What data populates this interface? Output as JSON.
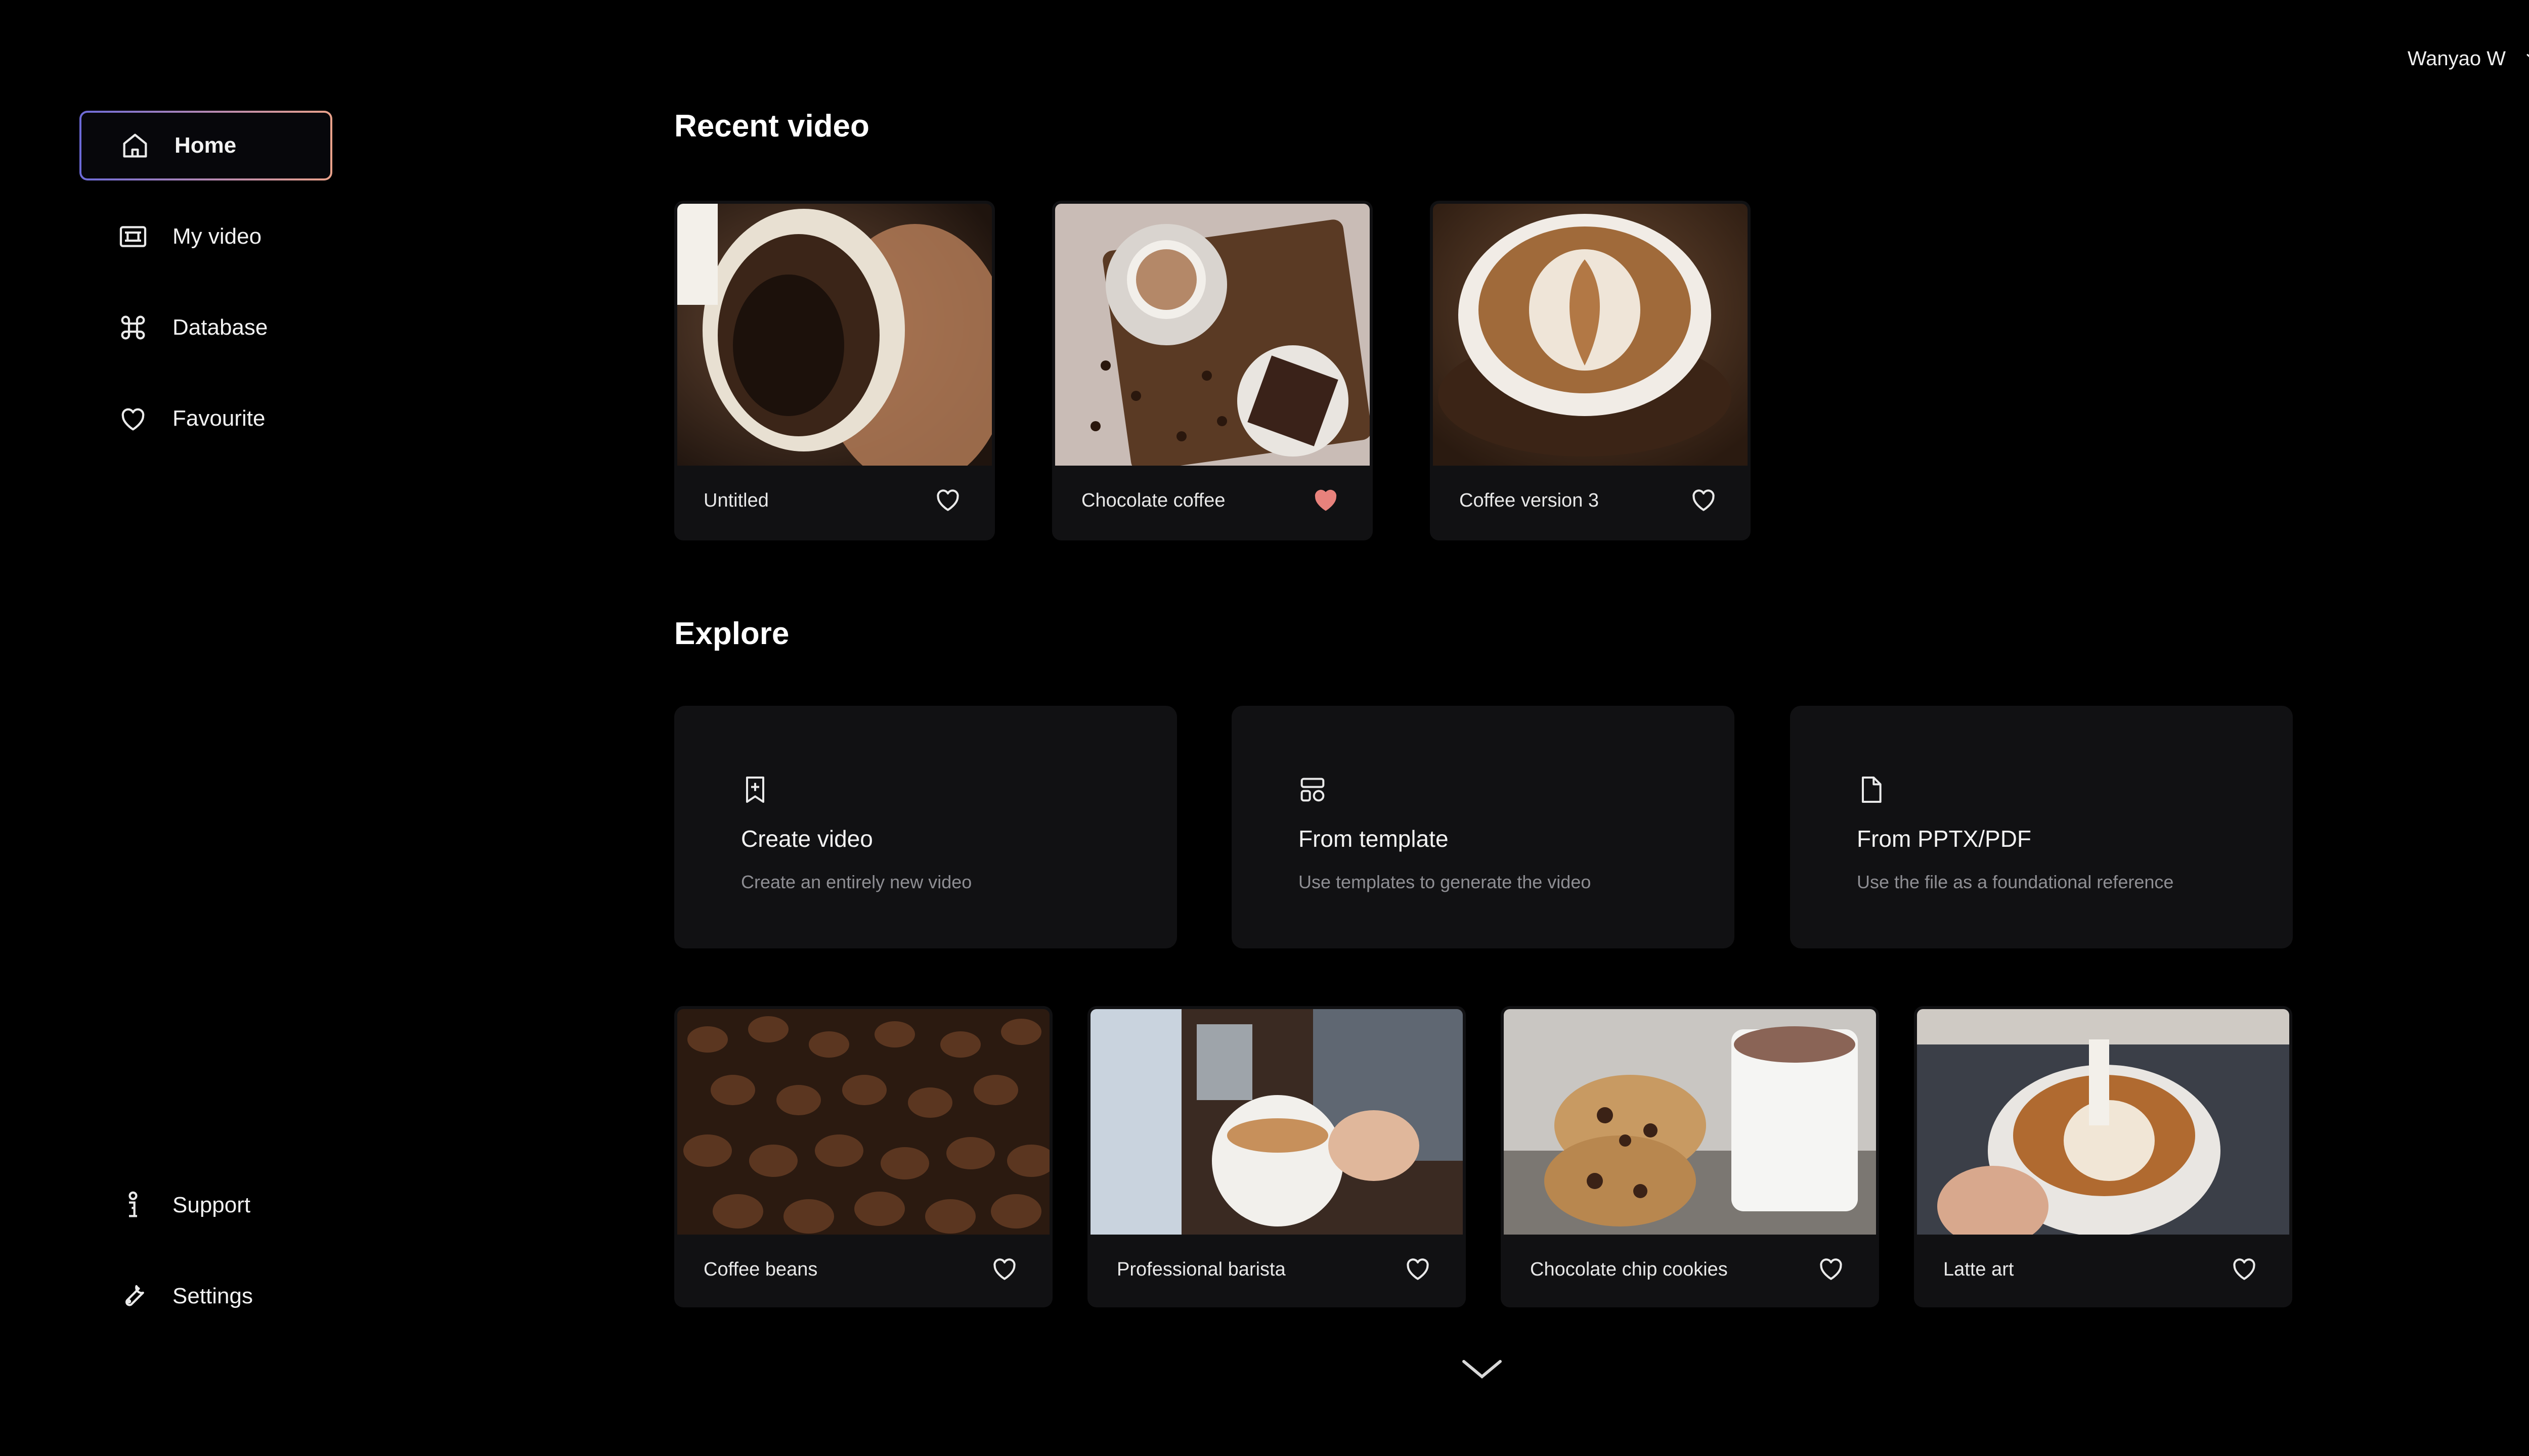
{
  "sidebar": {
    "items": [
      {
        "label": "Home",
        "icon": "home-icon",
        "active": true
      },
      {
        "label": "My video",
        "icon": "film-icon"
      },
      {
        "label": "Database",
        "icon": "command-icon"
      },
      {
        "label": "Favourite",
        "icon": "heart-icon"
      }
    ],
    "bottom_items": [
      {
        "label": "Support",
        "icon": "support-icon"
      },
      {
        "label": "Settings",
        "icon": "wrench-icon"
      }
    ]
  },
  "user": {
    "name": "Wanyao W",
    "icon": "chevron-down-icon"
  },
  "recent": {
    "title": "Recent video",
    "items": [
      {
        "title": "Untitled",
        "favourite": false
      },
      {
        "title": "Chocolate coffee",
        "favourite": true
      },
      {
        "title": "Coffee version 3",
        "favourite": false
      }
    ]
  },
  "explore": {
    "title": "Explore",
    "options": [
      {
        "title": "Create video",
        "desc": "Create an entirely new video",
        "icon": "sparkle-doc-icon"
      },
      {
        "title": "From template",
        "desc": "Use templates to generate the video",
        "icon": "template-icon"
      },
      {
        "title": "From PPTX/PDF",
        "desc": "Use the file as a foundational reference",
        "icon": "file-icon"
      }
    ],
    "items": [
      {
        "title": "Coffee beans",
        "favourite": false
      },
      {
        "title": "Professional barista",
        "favourite": false
      },
      {
        "title": "Chocolate chip cookies",
        "favourite": false
      },
      {
        "title": "Latte art",
        "favourite": false
      }
    ]
  },
  "colors": {
    "background": "#000000",
    "card": "#111113",
    "favourite_active": "#e8827c",
    "accent_gradient": [
      "#6c6ad8",
      "#e9a18a"
    ]
  }
}
